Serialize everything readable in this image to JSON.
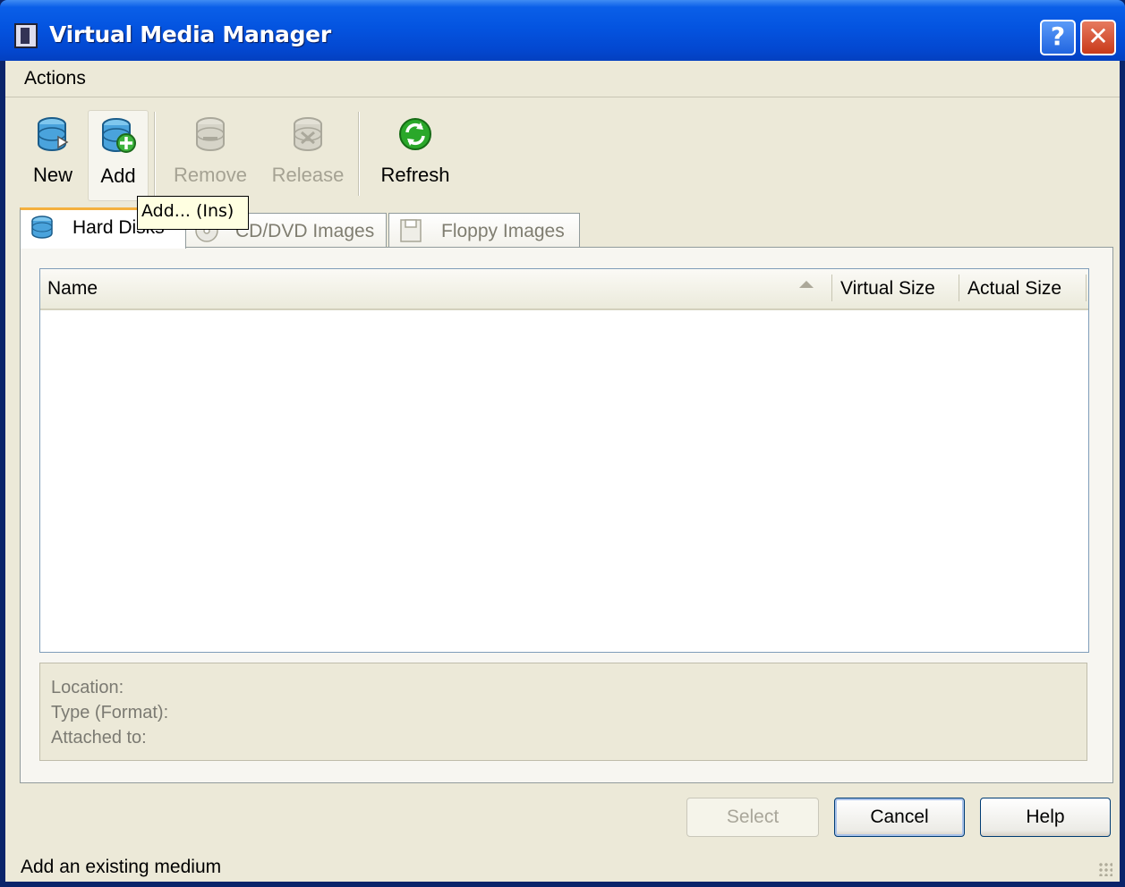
{
  "window": {
    "title": "Virtual Media Manager",
    "help_label": "?",
    "close_label": "✕"
  },
  "menubar": {
    "items": [
      {
        "label": "Actions"
      }
    ]
  },
  "toolbar": {
    "new_label": "New",
    "add_label": "Add",
    "remove_label": "Remove",
    "release_label": "Release",
    "refresh_label": "Refresh"
  },
  "tooltip": {
    "text": "Add... (Ins)"
  },
  "tabs": [
    {
      "label": "Hard Disks",
      "icon": "hard-disk-icon"
    },
    {
      "label": "CD/DVD Images",
      "icon": "cd-dvd-icon"
    },
    {
      "label": "Floppy Images",
      "icon": "floppy-icon"
    }
  ],
  "table": {
    "columns": [
      {
        "label": "Name"
      },
      {
        "label": "Virtual Size"
      },
      {
        "label": "Actual Size"
      }
    ],
    "rows": []
  },
  "details": {
    "location_label": "Location:",
    "type_label": "Type (Format):",
    "attached_label": "Attached to:"
  },
  "buttons": {
    "select_label": "Select",
    "cancel_label": "Cancel",
    "help_label": "Help"
  },
  "statusbar": {
    "text": "Add an existing medium"
  },
  "colors": {
    "titlebar": "#0454e0",
    "face": "#ece9d8",
    "accent_tab": "#f4b03e",
    "refresh_icon": "#2aa82a"
  }
}
